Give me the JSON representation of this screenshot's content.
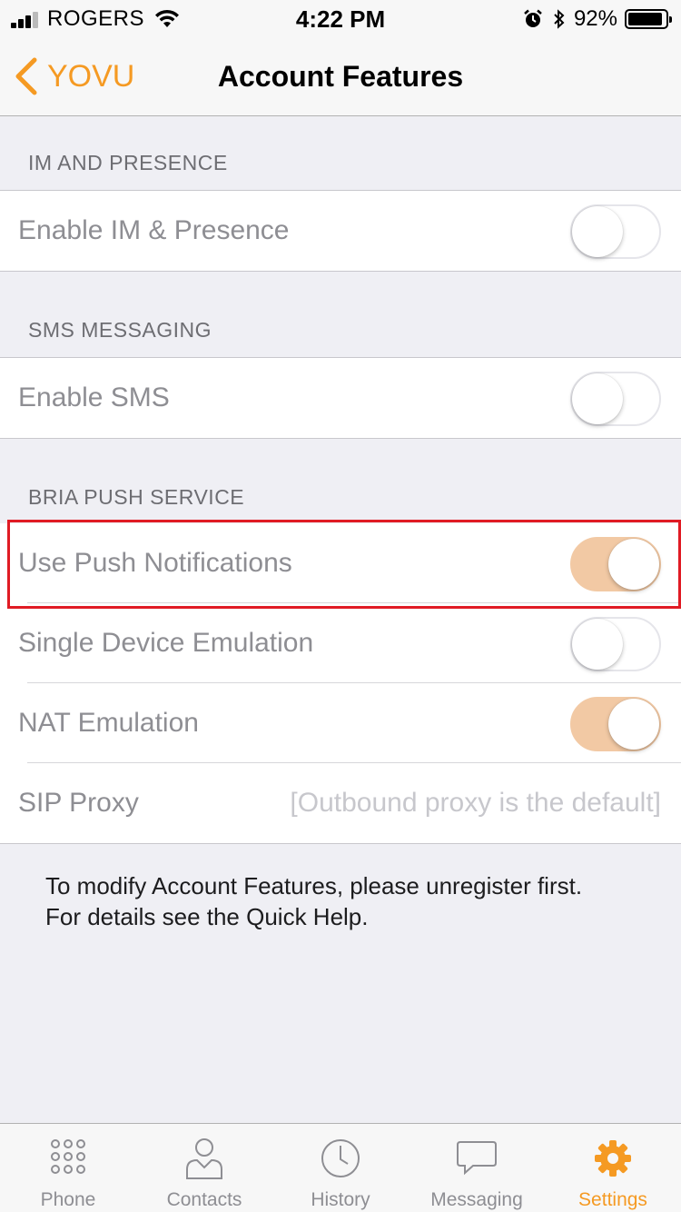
{
  "status_bar": {
    "carrier": "ROGERS",
    "time": "4:22 PM",
    "battery": "92%",
    "battery_level": 0.92
  },
  "nav": {
    "back_label": "YOVU",
    "title": "Account Features"
  },
  "sections": [
    {
      "header": "IM AND PRESENCE",
      "rows": [
        {
          "label": "Enable IM & Presence",
          "toggle": false
        }
      ]
    },
    {
      "header": "SMS MESSAGING",
      "rows": [
        {
          "label": "Enable SMS",
          "toggle": false
        }
      ]
    },
    {
      "header": "BRIA PUSH SERVICE",
      "rows": [
        {
          "label": "Use Push Notifications",
          "toggle": true
        },
        {
          "label": "Single Device Emulation",
          "toggle": false
        },
        {
          "label": "NAT Emulation",
          "toggle": true
        },
        {
          "label": "SIP Proxy",
          "placeholder": "[Outbound proxy is the default]"
        }
      ]
    }
  ],
  "footer_note": {
    "line1": "To modify Account Features, please unregister first.",
    "line2": "For details see the Quick Help."
  },
  "tabs": [
    {
      "label": "Phone",
      "icon": "dialpad-icon",
      "active": false
    },
    {
      "label": "Contacts",
      "icon": "contacts-icon",
      "active": false
    },
    {
      "label": "History",
      "icon": "clock-icon",
      "active": false
    },
    {
      "label": "Messaging",
      "icon": "chat-bubble-icon",
      "active": false
    },
    {
      "label": "Settings",
      "icon": "gear-icon",
      "active": true
    }
  ],
  "colors": {
    "accent": "#f59a23",
    "toggle_on": "#f2c9a4",
    "highlight": "#e01b24"
  }
}
